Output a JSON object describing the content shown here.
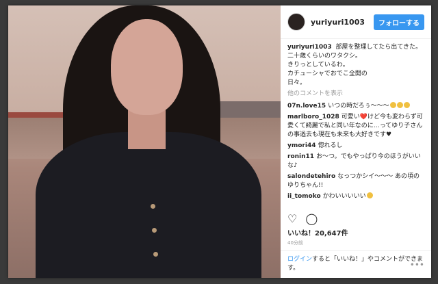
{
  "post": {
    "username": "yuriyuri1003",
    "follow_label": "フォローする",
    "caption_user": "yuriyuri1003",
    "caption_lines": [
      "部屋を整理してたら出てきた。",
      "二十歳くらいのワタクシ。",
      "きりっとしているわ。",
      "カチューシャでおでこ全開の",
      "日々。"
    ],
    "more_comments": "他のコメントを表示",
    "comments": [
      {
        "user": "07n.love15",
        "text": "いつの時だろぅ〜〜〜"
      },
      {
        "user": "marlboro_1028",
        "text": "可愛い❤️けど今も変わらず可愛くて綺麗で私と同い年なのに…ってゆり子さんの事過去も現在も未来も大好きです♥"
      },
      {
        "user": "ymori44",
        "text": "惚れるし"
      },
      {
        "user": "ronin11",
        "text": "お〜つ。でもやっぱり今のほうがいいな♪"
      },
      {
        "user": "salondetehiro",
        "text": "なっつかシイ〜〜〜 あの頃のゆりちゃん!!"
      },
      {
        "user": "ii_tomoko",
        "text": "かわいいいいい"
      }
    ],
    "likes": "いいね！20,647件",
    "time": "40分前",
    "footer_login": "ログイン",
    "footer_text": "すると「いいね！」やコメントができます。",
    "more_icon": "ellipsis-icon"
  }
}
